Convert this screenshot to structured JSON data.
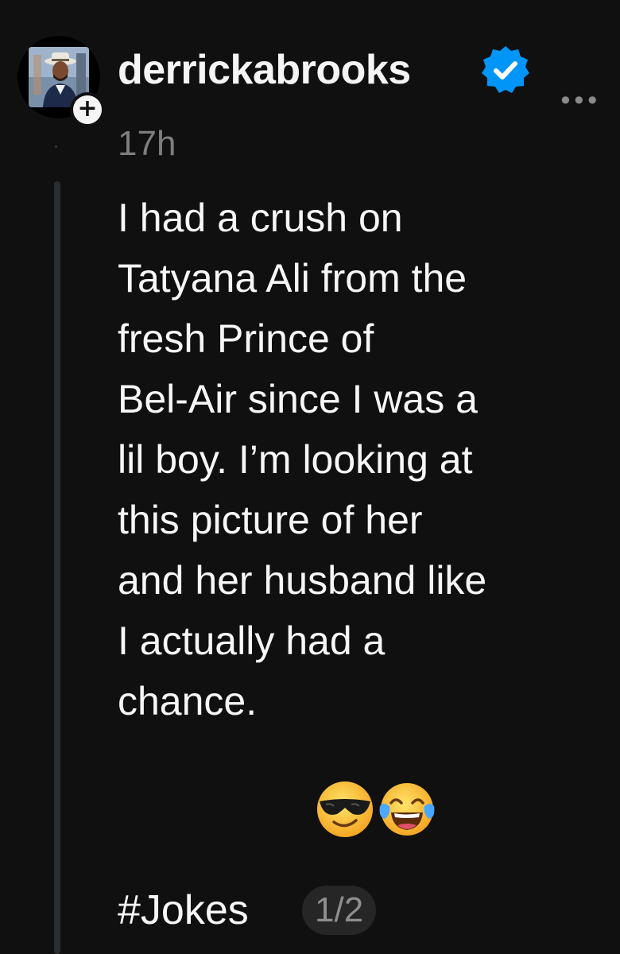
{
  "post": {
    "username": "derrickabrooks",
    "verified_icon": "verified-badge-icon",
    "timestamp": "17h",
    "more_label": "•••",
    "follow_label": "+",
    "body": "I had a crush on\nTatyana Ali from the\nfresh Prince of\nBel-Air since I was a\nlil boy. I’m looking at\nthis picture of her\nand her husband like\nI actually had a\nchance.",
    "emojis": [
      "smiling-face-with-sunglasses-emoji",
      "face-with-tears-of-joy-emoji"
    ],
    "hashtag": "#Jokes",
    "counter": "1/2"
  },
  "colors": {
    "background": "#101010",
    "verified": "#0095f6",
    "text": "#f7f7f7",
    "muted": "#7e7e7e"
  }
}
